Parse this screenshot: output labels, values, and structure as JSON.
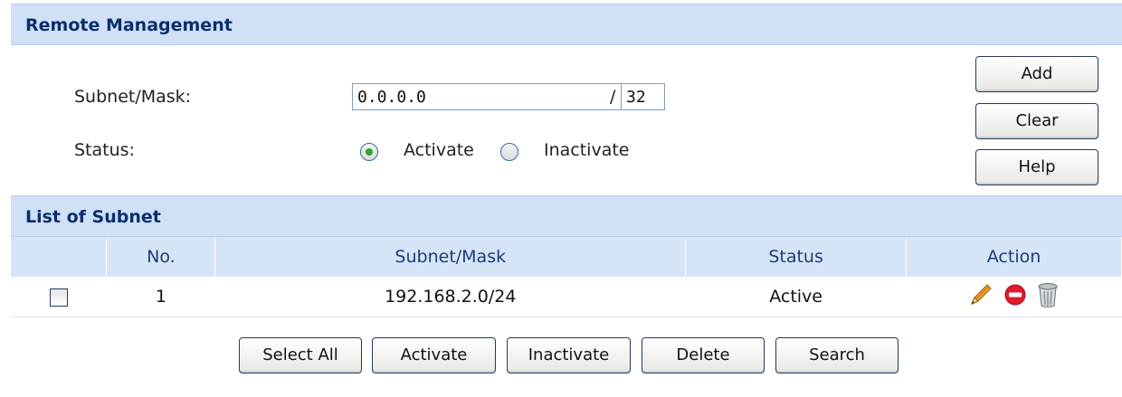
{
  "remote_management": {
    "title": "Remote Management",
    "subnet_mask_label": "Subnet/Mask:",
    "subnet_value": "0.0.0.0",
    "slash": "/",
    "mask_value": "32",
    "status_label": "Status:",
    "status_options": [
      {
        "label": "Activate",
        "selected": true
      },
      {
        "label": "Inactivate",
        "selected": false
      }
    ],
    "buttons": {
      "add": "Add",
      "clear": "Clear",
      "help": "Help"
    }
  },
  "subnet_list": {
    "title": "List of Subnet",
    "columns": [
      "",
      "No.",
      "Subnet/Mask",
      "Status",
      "Action"
    ],
    "rows": [
      {
        "no": "1",
        "subnet_mask": "192.168.2.0/24",
        "status": "Active",
        "checked": false,
        "actions": [
          "pencil-edit-icon",
          "red-minus-disable-icon",
          "trash-bin-icon"
        ]
      }
    ]
  },
  "bottom_buttons": {
    "select_all": "Select All",
    "activate": "Activate",
    "inactivate": "Inactivate",
    "delete": "Delete",
    "search": "Search"
  },
  "colors": {
    "header_bg": "#cfe0f7",
    "header_text": "#0b2f6b",
    "radio_selected": "#2da42d",
    "disable_icon": "#e0192d"
  }
}
